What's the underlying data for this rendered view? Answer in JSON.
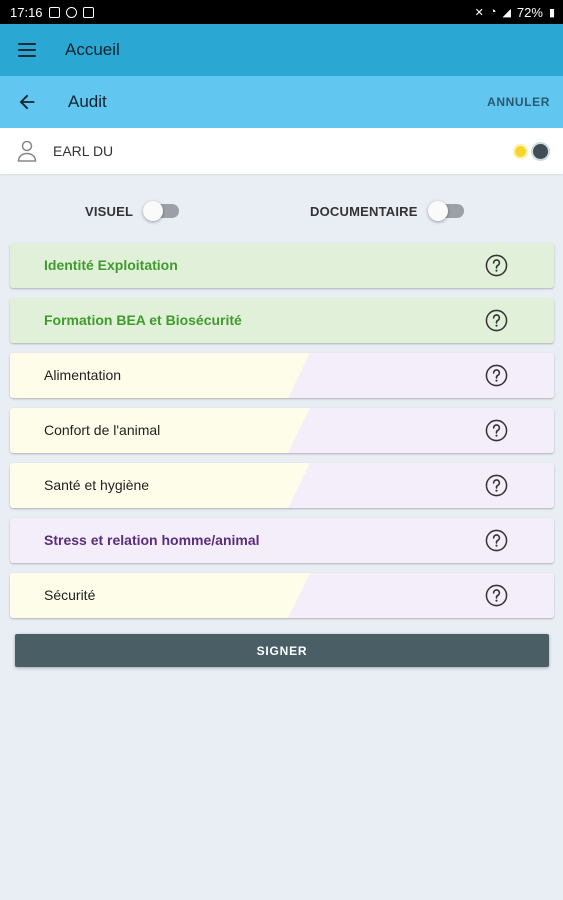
{
  "status_bar": {
    "time": "17:16",
    "battery": "72%",
    "icons": [
      "image-icon",
      "sync-icon",
      "app-icon",
      "mute-icon",
      "wifi-icon",
      "signal-icon",
      "battery-icon"
    ]
  },
  "app_bar": {
    "title": "Accueil",
    "menu_icon": "hamburger-icon"
  },
  "sub_bar": {
    "title": "Audit",
    "cancel_label": "ANNULER",
    "back_icon": "arrow-left-icon"
  },
  "farm": {
    "name": "EARL DU",
    "icon": "user-icon",
    "indicators": [
      {
        "name": "yellow-indicator",
        "color": "#f6d429"
      },
      {
        "name": "dark-indicator",
        "color": "#3f4e56"
      }
    ]
  },
  "toggles": {
    "visuel_label": "VISUEL",
    "visuel_on": false,
    "documentaire_label": "DOCUMENTAIRE",
    "documentaire_on": false
  },
  "sections": [
    {
      "label": "Identité Exploitation",
      "style": "green",
      "help_icon": "question-circle-icon"
    },
    {
      "label": "Formation BEA et Biosécurité",
      "style": "green",
      "help_icon": "question-circle-icon"
    },
    {
      "label": "Alimentation",
      "style": "split",
      "help_icon": "question-circle-icon"
    },
    {
      "label": "Confort de l'animal",
      "style": "split",
      "help_icon": "question-circle-icon"
    },
    {
      "label": "Santé et hygiène",
      "style": "split",
      "help_icon": "question-circle-icon"
    },
    {
      "label": "Stress et relation homme/animal",
      "style": "purple",
      "help_icon": "question-circle-icon"
    },
    {
      "label": "Sécurité",
      "style": "split",
      "help_icon": "question-circle-icon"
    }
  ],
  "sign_button": {
    "label": "SIGNER"
  },
  "colors": {
    "app_bar": "#2aa7d3",
    "sub_bar": "#62c7f0",
    "green_section": "#e1f0d9",
    "green_text": "#3f9b2c",
    "purple_section": "#f4eefb",
    "purple_text": "#5a2d7a",
    "yellow_section": "#fdfde9",
    "sign_button": "#4a5e66",
    "page_bg": "#e9edf4"
  }
}
